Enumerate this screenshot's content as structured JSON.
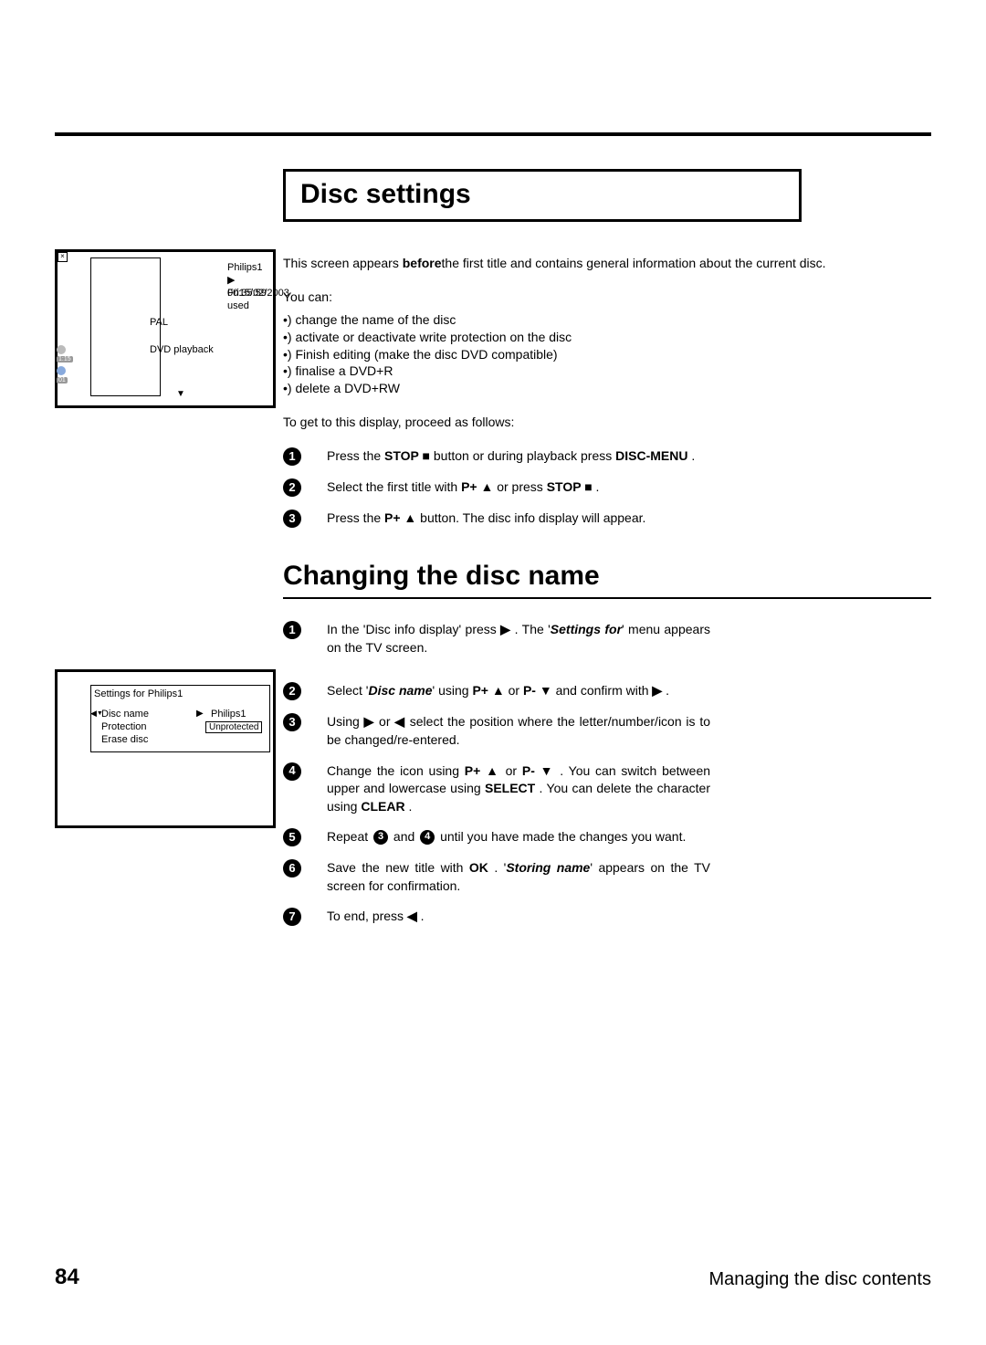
{
  "section_title": "Disc settings",
  "screen1": {
    "title": "Philips1",
    "used": "00:35:59 used",
    "date": "Fri15/02/2003",
    "pal": "PAL",
    "playback": "DVD playback",
    "label_top": "1:15",
    "label_bot": "01"
  },
  "intro1": "This screen appears ",
  "intro1b": "before",
  "intro1c": "the first title and contains general information about the current disc.",
  "youcan": "You can:",
  "bullets": [
    "•) change the name of the disc",
    "•) activate or deactivate write protection on the disc",
    "•) Finish editing (make the disc DVD compatible)",
    "•) finalise a DVD+R",
    "•) delete a DVD+RW"
  ],
  "proceed": "To get to this display, proceed as follows:",
  "stepsA": {
    "s1a": "Press the ",
    "s1b": "STOP ■",
    "s1c": " button or during playback press ",
    "s1d": "DISC-MENU",
    "s1e": " .",
    "s2a": "Select the first title with ",
    "s2b": "P+ ▲",
    "s2c": " or press ",
    "s2d": "STOP ■",
    "s2e": " .",
    "s3a": "Press the ",
    "s3b": "P+ ▲",
    "s3c": " button. The disc info display will appear."
  },
  "subhead": "Changing the disc name",
  "screen2": {
    "title": "Settings for Philips1",
    "r1": "Disc name",
    "r2": "Protection",
    "r3": "Erase disc",
    "v1": "Philips1",
    "v2": "Unprotected"
  },
  "stepsB": {
    "s1a": "In the 'Disc info display' press ",
    "s1b": "▶",
    "s1c": " . The '",
    "s1d": "Settings for",
    "s1e": "' menu appears on the TV screen.",
    "s2a": "Select '",
    "s2b": "Disc name",
    "s2c": "' using ",
    "s2d": "P+ ▲",
    "s2e": " or ",
    "s2f": "P- ▼",
    "s2g": " and confirm with ",
    "s2h": "▶",
    "s2i": " .",
    "s3a": "Using ",
    "s3b": "▶",
    "s3c": " or ",
    "s3d": "◀",
    "s3e": " select the position where the letter/number/icon is to be changed/re-entered.",
    "s4a": "Change the icon using ",
    "s4b": "P+ ▲",
    "s4c": " or ",
    "s4d": "P- ▼",
    "s4e": " . You can switch between upper and lowercase using ",
    "s4f": "SELECT",
    "s4g": " . You can delete the character using ",
    "s4h": "CLEAR",
    "s4i": " .",
    "s5a": "Repeat ",
    "s5b": " and ",
    "s5c": " until you have made the changes you want.",
    "s6a": "Save the new title with ",
    "s6b": "OK",
    "s6c": " . '",
    "s6d": "Storing name",
    "s6e": "' appears on the TV screen for confirmation.",
    "s7a": "To end, press ",
    "s7b": "◀",
    "s7c": " ."
  },
  "page_number": "84",
  "chapter": "Managing the disc contents"
}
